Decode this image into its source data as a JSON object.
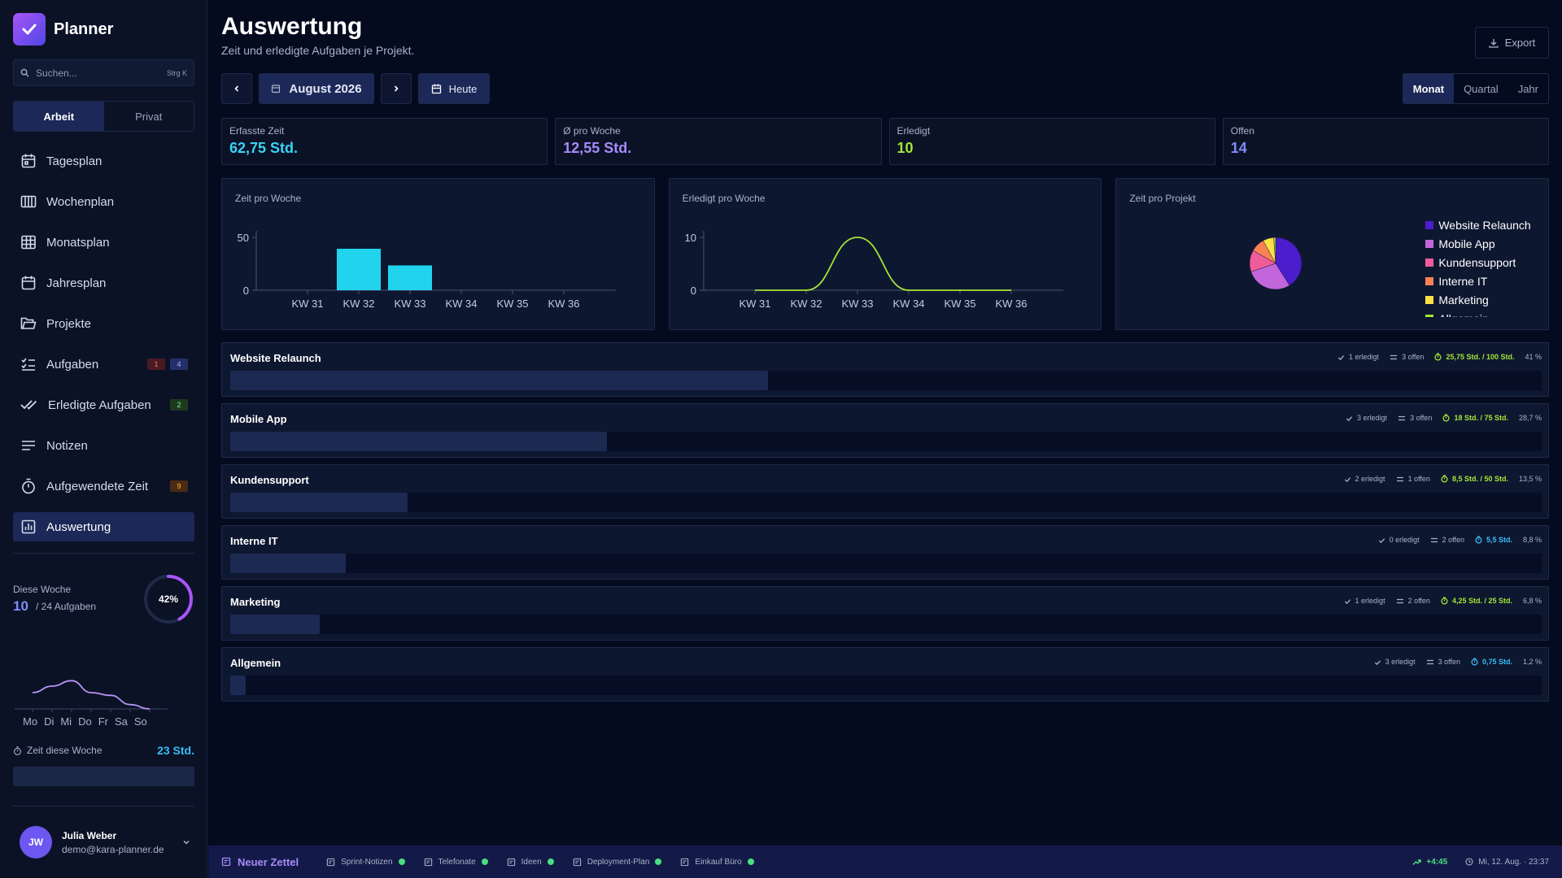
{
  "app": {
    "name": "Planner"
  },
  "search": {
    "placeholder": "Suchen...",
    "shortcut": "Strg K"
  },
  "modes": [
    "Arbeit",
    "Privat"
  ],
  "sidebar": {
    "items": [
      {
        "label": "Tagesplan",
        "icon": "calendar-day-icon"
      },
      {
        "label": "Wochenplan",
        "icon": "calendar-week-icon"
      },
      {
        "label": "Monatsplan",
        "icon": "grid-icon"
      },
      {
        "label": "Jahresplan",
        "icon": "calendar-icon"
      },
      {
        "label": "Projekte",
        "icon": "folder-icon"
      },
      {
        "label": "Aufgaben",
        "icon": "checklist-icon",
        "badges": [
          "1",
          "4"
        ]
      },
      {
        "label": "Erledigte Aufgaben",
        "icon": "double-check-icon",
        "badges": [
          "2"
        ]
      },
      {
        "label": "Notizen",
        "icon": "lines-icon"
      },
      {
        "label": "Aufgewendete Zeit",
        "icon": "stopwatch-icon",
        "badges": [
          "9"
        ]
      },
      {
        "label": "Auswertung",
        "icon": "bar-chart-icon"
      }
    ]
  },
  "week": {
    "label": "Diese Woche",
    "done": "10",
    "total": "/ 24 Aufgaben",
    "percent": "42%",
    "progress": 0.42
  },
  "week_chart": {
    "days": [
      "Mo",
      "Di",
      "Mi",
      "Do",
      "Fr",
      "Sa",
      "So"
    ],
    "values": [
      3,
      4.2,
      5.2,
      3,
      2.5,
      0.8,
      0
    ]
  },
  "time_week": {
    "label": "Zeit diese Woche",
    "value": "23 Std."
  },
  "user": {
    "initials": "JW",
    "name": "Julia Weber",
    "email": "demo@kara-planner.de"
  },
  "header": {
    "title": "Auswertung",
    "subtitle": "Zeit und erledigte Aufgaben je Projekt.",
    "export": "Export",
    "month": "August 2026",
    "today": "Heute"
  },
  "ranges": [
    "Monat",
    "Quartal",
    "Jahr"
  ],
  "stats": [
    {
      "label": "Erfasste Zeit",
      "value": "62,75 Std.",
      "color": "#38d3f5"
    },
    {
      "label": "Ø pro Woche",
      "value": "12,55 Std.",
      "color": "#a78bfa"
    },
    {
      "label": "Erledigt",
      "value": "10",
      "color": "#a3e635"
    },
    {
      "label": "Offen",
      "value": "14",
      "color": "#818cf8"
    }
  ],
  "charts": {
    "time_title": "Zeit pro Woche",
    "done_title": "Erledigt pro Woche",
    "project_title": "Zeit pro Projekt"
  },
  "chart_data": [
    {
      "type": "bar",
      "title": "Zeit pro Woche",
      "categories": [
        "KW 31",
        "KW 32",
        "KW 33",
        "KW 34",
        "KW 35",
        "KW 36"
      ],
      "values": [
        0,
        39.25,
        23.5,
        0,
        0,
        0
      ],
      "ylim": [
        0,
        50
      ],
      "yticks": [
        0,
        50
      ],
      "color": "#22d3ee"
    },
    {
      "type": "line",
      "title": "Erledigt pro Woche",
      "categories": [
        "KW 31",
        "KW 32",
        "KW 33",
        "KW 34",
        "KW 35",
        "KW 36"
      ],
      "values": [
        0,
        0,
        10,
        0,
        0,
        0
      ],
      "ylim": [
        0,
        10
      ],
      "yticks": [
        0,
        10
      ],
      "color": "#a3e635"
    },
    {
      "type": "pie",
      "title": "Zeit pro Projekt",
      "labels": [
        "Website Relaunch",
        "Mobile App",
        "Kundensupport",
        "Interne IT",
        "Marketing",
        "Allgemein"
      ],
      "values": [
        25.75,
        18,
        8.5,
        5.5,
        4.25,
        0.75
      ],
      "colors": [
        "#4c1dcc",
        "#c266dc",
        "#f05c9b",
        "#fb8254",
        "#fde047",
        "#a3e635"
      ]
    }
  ],
  "projects": [
    {
      "name": "Website Relaunch",
      "done": "1 erledigt",
      "open": "3 offen",
      "hours": "25,75 Std. / 100 Std.",
      "percent": "41 %",
      "progress": 0.41,
      "hours_color": "#a3e635"
    },
    {
      "name": "Mobile App",
      "done": "3 erledigt",
      "open": "3 offen",
      "hours": "18 Std. / 75 Std.",
      "percent": "28,7 %",
      "progress": 0.287,
      "hours_color": "#a3e635"
    },
    {
      "name": "Kundensupport",
      "done": "2 erledigt",
      "open": "1 offen",
      "hours": "8,5 Std. / 50 Std.",
      "percent": "13,5 %",
      "progress": 0.135,
      "hours_color": "#a3e635"
    },
    {
      "name": "Interne IT",
      "done": "0 erledigt",
      "open": "2 offen",
      "hours": "5,5 Std.",
      "percent": "8,8 %",
      "progress": 0.088,
      "hours_color": "#38bdf8"
    },
    {
      "name": "Marketing",
      "done": "1 erledigt",
      "open": "2 offen",
      "hours": "4,25 Std. / 25 Std.",
      "percent": "6,8 %",
      "progress": 0.068,
      "hours_color": "#a3e635"
    },
    {
      "name": "Allgemein",
      "done": "3 erledigt",
      "open": "3 offen",
      "hours": "0,75 Std.",
      "percent": "1,2 %",
      "progress": 0.012,
      "hours_color": "#38bdf8"
    }
  ],
  "bottom": {
    "new_note": "Neuer Zettel",
    "notes": [
      "Sprint-Notizen",
      "Telefonate",
      "Ideen",
      "Deployment-Plan",
      "Einkauf Büro"
    ],
    "delta": "+4:45",
    "datetime": "Mi, 12. Aug. · 23:37"
  }
}
